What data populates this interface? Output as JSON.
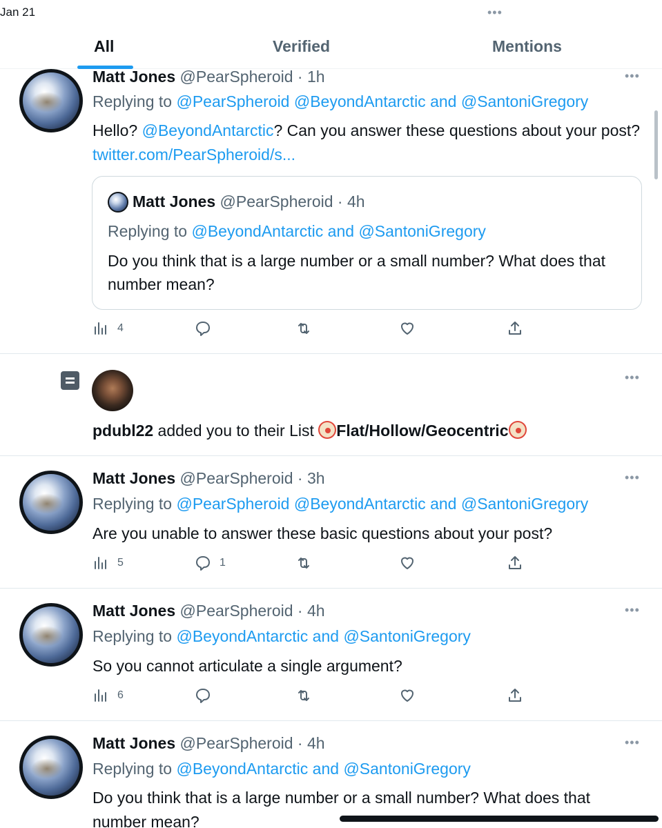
{
  "status": {
    "date": "Jan 21",
    "dots": "•••"
  },
  "tabs": [
    {
      "label": "All",
      "active": true
    },
    {
      "label": "Verified",
      "active": false
    },
    {
      "label": "Mentions",
      "active": false
    }
  ],
  "more_label": "•••",
  "notifications": [
    {
      "name": "Matt Jones",
      "handle": "@PearSpheroid",
      "time": "· 1h",
      "replying_prefix": "Replying to",
      "replying_to": "@PearSpheroid @BeyondAntarctic and @SantoniGregory",
      "text_before": "Hello? ",
      "text_mention": "@BeyondAntarctic",
      "text_after": "? Can you answer these questions about your post? ",
      "text_link": "twitter.com/PearSpheroid/s...",
      "quote": {
        "name": "Matt Jones",
        "handle": "@PearSpheroid",
        "time": "· 4h",
        "replying_prefix": "Replying to",
        "replying_to": "@BeyondAntarctic and @SantoniGregory",
        "text": "Do you think that is a large number or a small number? What does that number mean?"
      },
      "views": "4",
      "replies": ""
    },
    {
      "type": "list_add",
      "user": "pdubl22",
      "text": " added you to their List ",
      "list_name": "Flat/Hollow/Geocentric"
    },
    {
      "name": "Matt Jones",
      "handle": "@PearSpheroid",
      "time": "· 3h",
      "replying_prefix": "Replying to",
      "replying_to": "@PearSpheroid @BeyondAntarctic and @SantoniGregory",
      "text": "Are you unable to answer these basic questions about your post?",
      "views": "5",
      "replies": "1"
    },
    {
      "name": "Matt Jones",
      "handle": "@PearSpheroid",
      "time": "· 4h",
      "replying_prefix": "Replying to",
      "replying_to": "@BeyondAntarctic and @SantoniGregory",
      "text": "So you cannot articulate a single argument?",
      "views": "6",
      "replies": ""
    },
    {
      "name": "Matt Jones",
      "handle": "@PearSpheroid",
      "time": "· 4h",
      "replying_prefix": "Replying to",
      "replying_to": "@BeyondAntarctic and @SantoniGregory",
      "text": "Do you think that is a large number or a small number? What does that number mean?"
    }
  ],
  "colors": {
    "accent": "#1d9bf0",
    "muted": "#536471",
    "text": "#0f1419"
  }
}
